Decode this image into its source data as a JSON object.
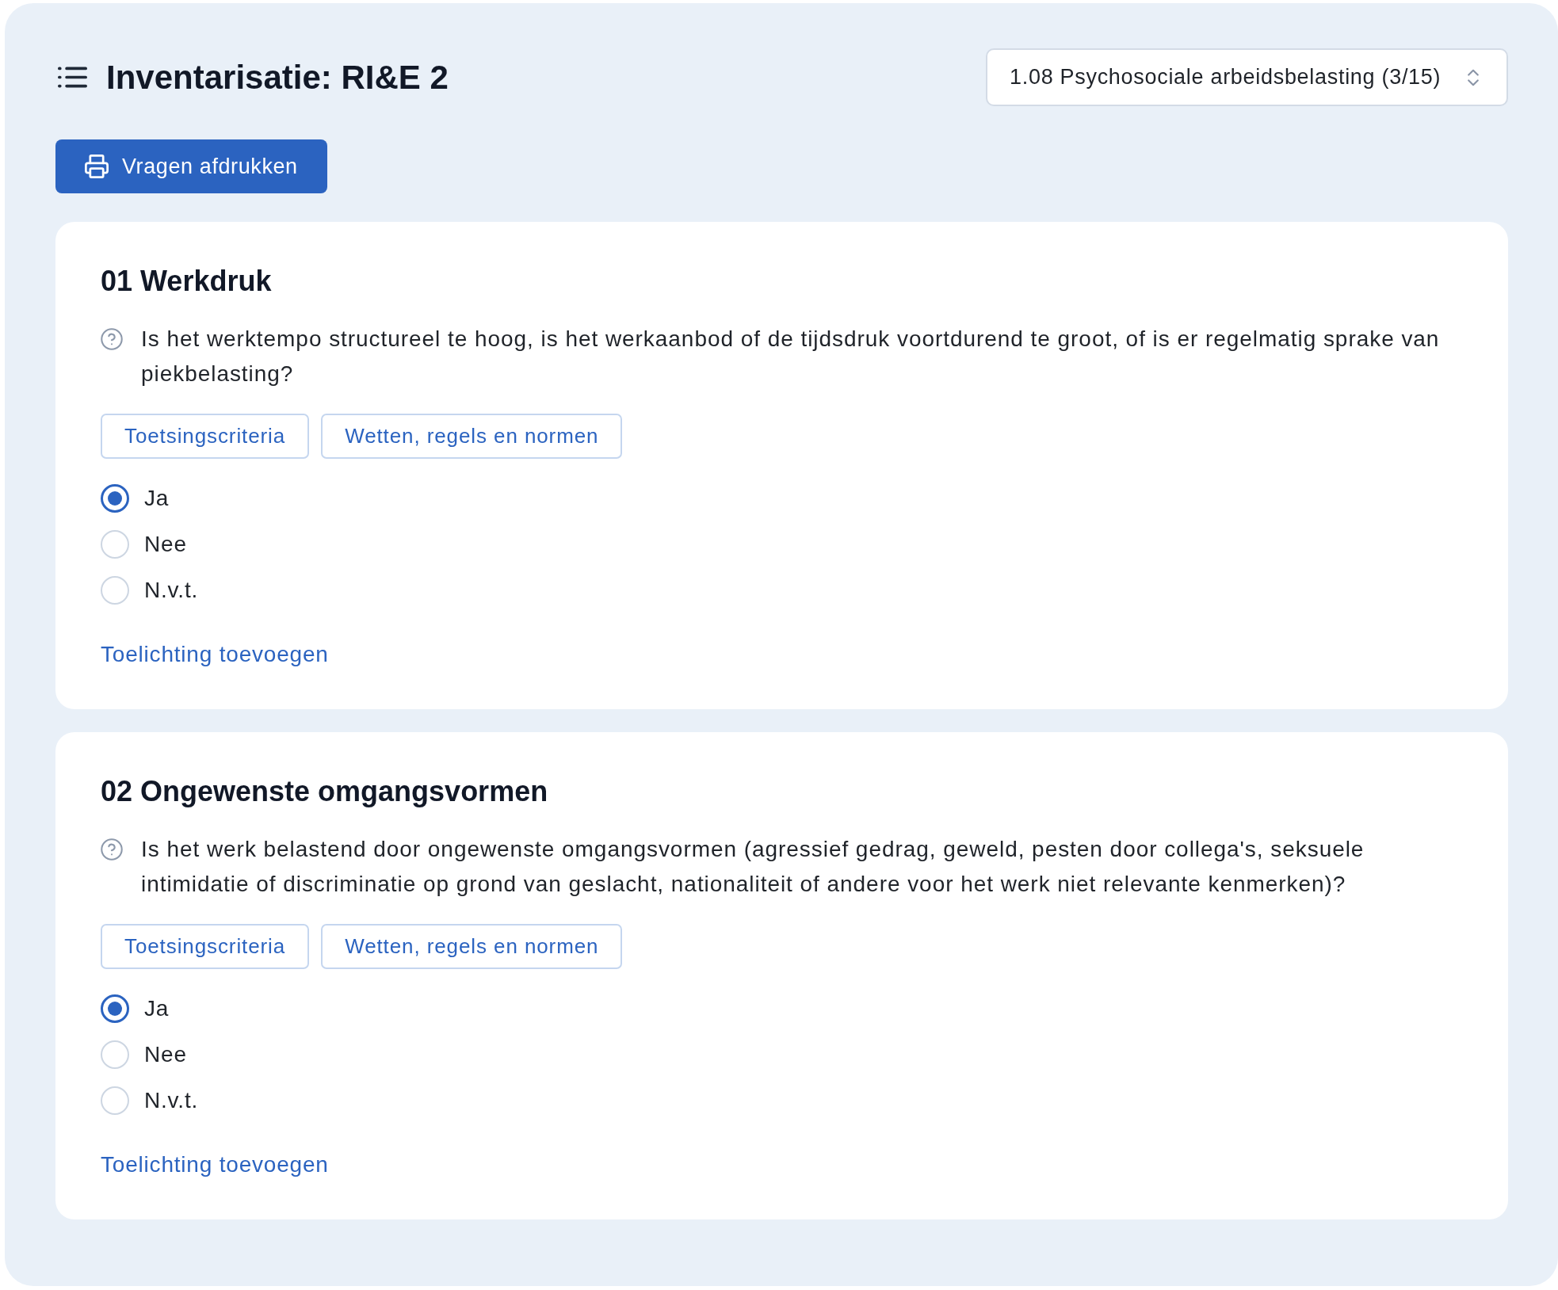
{
  "header": {
    "title": "Inventarisatie: RI&E 2",
    "section_select": {
      "value": "1.08 Psychosociale arbeidsbelasting (3/15)"
    }
  },
  "print_button": {
    "label": "Vragen afdrukken"
  },
  "questions": [
    {
      "title": "01 Werkdruk",
      "question": "Is het werktempo structureel te hoog, is het werkaanbod of de tijdsdruk voortdurend te groot, of is er regelmatig sprake van piekbelasting?",
      "info_buttons": [
        "Toetsingscriteria",
        "Wetten, regels en normen"
      ],
      "options": [
        {
          "label": "Ja",
          "selected": true
        },
        {
          "label": "Nee",
          "selected": false
        },
        {
          "label": "N.v.t.",
          "selected": false
        }
      ],
      "link": "Toelichting toevoegen"
    },
    {
      "title": "02 Ongewenste omgangsvormen",
      "question": "Is het werk belastend door ongewenste omgangsvormen (agressief gedrag, geweld, pesten door collega's, seksuele intimidatie of discriminatie op grond van geslacht, nationaliteit of andere voor het werk niet relevante kenmerken)?",
      "info_buttons": [
        "Toetsingscriteria",
        "Wetten, regels en normen"
      ],
      "options": [
        {
          "label": "Ja",
          "selected": true
        },
        {
          "label": "Nee",
          "selected": false
        },
        {
          "label": "N.v.t.",
          "selected": false
        }
      ],
      "link": "Toelichting toevoegen"
    }
  ]
}
